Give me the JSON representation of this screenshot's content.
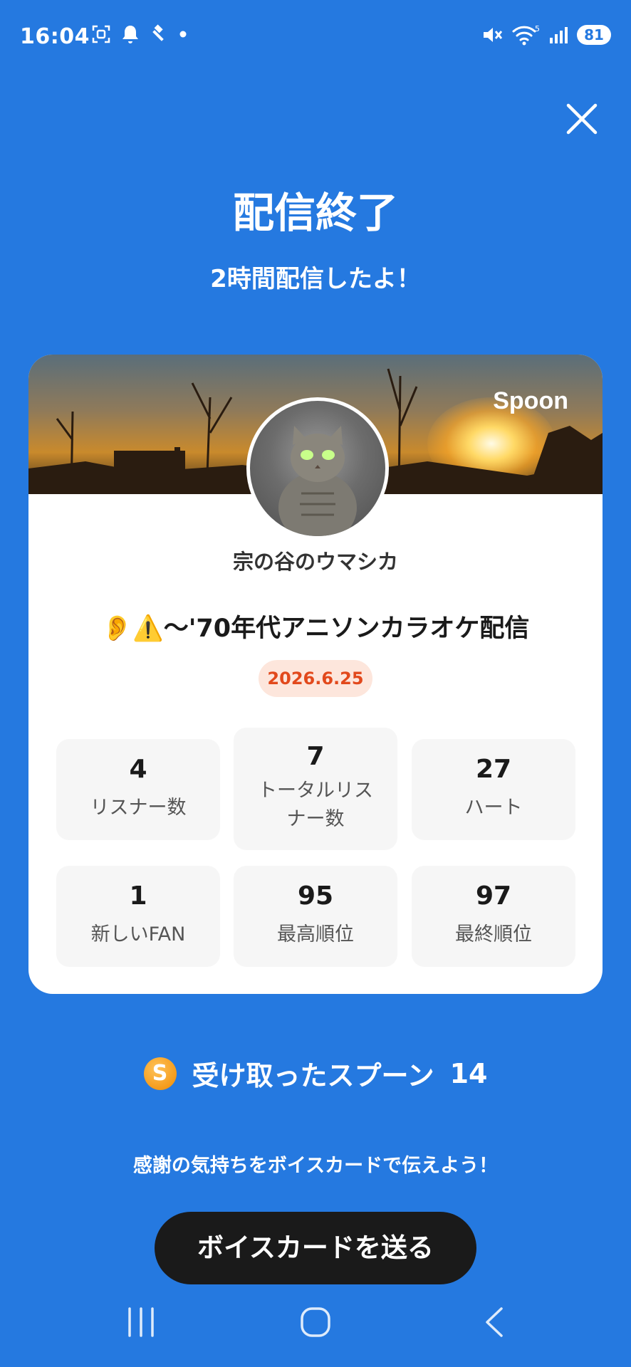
{
  "status_bar": {
    "time": "16:04",
    "battery": "81",
    "wifi_level": "5"
  },
  "header": {
    "title": "配信終了",
    "subtitle": "2時間配信したよ！"
  },
  "card": {
    "brand": "Spoon",
    "username": "宗の谷のウマシカ",
    "stream_title": "👂⚠️〜'70年代アニソンカラオケ配信",
    "date": "2026.6.25",
    "stats": [
      {
        "value": "4",
        "label": "リスナー数"
      },
      {
        "value": "7",
        "label": "トータルリス",
        "label2": "ナー数"
      },
      {
        "value": "27",
        "label": "ハート"
      },
      {
        "value": "1",
        "label": "新しいFAN"
      },
      {
        "value": "95",
        "label": "最高順位"
      },
      {
        "value": "97",
        "label": "最終順位"
      }
    ]
  },
  "spoons": {
    "coin_letter": "S",
    "label": "受け取ったスプーン",
    "count": "14"
  },
  "thanks_text": "感謝の気持ちをボイスカードで伝えよう！",
  "send_button": "ボイスカードを送る"
}
